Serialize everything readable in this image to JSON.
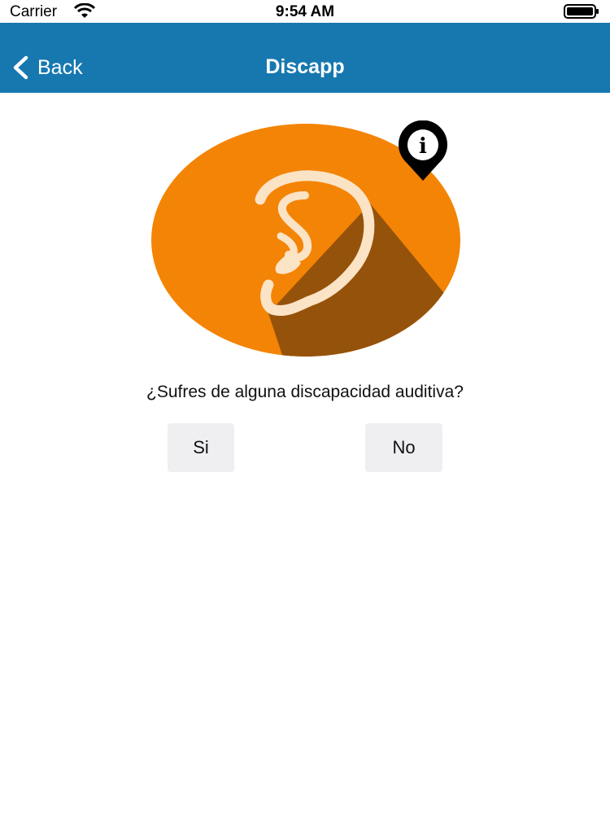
{
  "status_bar": {
    "carrier": "Carrier",
    "time": "9:54 AM",
    "wifi_icon": "wifi-icon",
    "battery_icon": "battery-icon"
  },
  "nav": {
    "back_label": "Back",
    "title": "Discapp",
    "back_icon": "chevron-left-icon",
    "bar_color": "#1778b0"
  },
  "hero": {
    "icon": "ear-icon",
    "badge_icon": "info-pin-icon",
    "circle_color": "#f48405",
    "shadow_color": "#95520a",
    "ear_color": "#fbe3c6"
  },
  "question": "¿Sufres de alguna discapacidad auditiva?",
  "buttons": {
    "yes_label": "Si",
    "no_label": "No"
  }
}
